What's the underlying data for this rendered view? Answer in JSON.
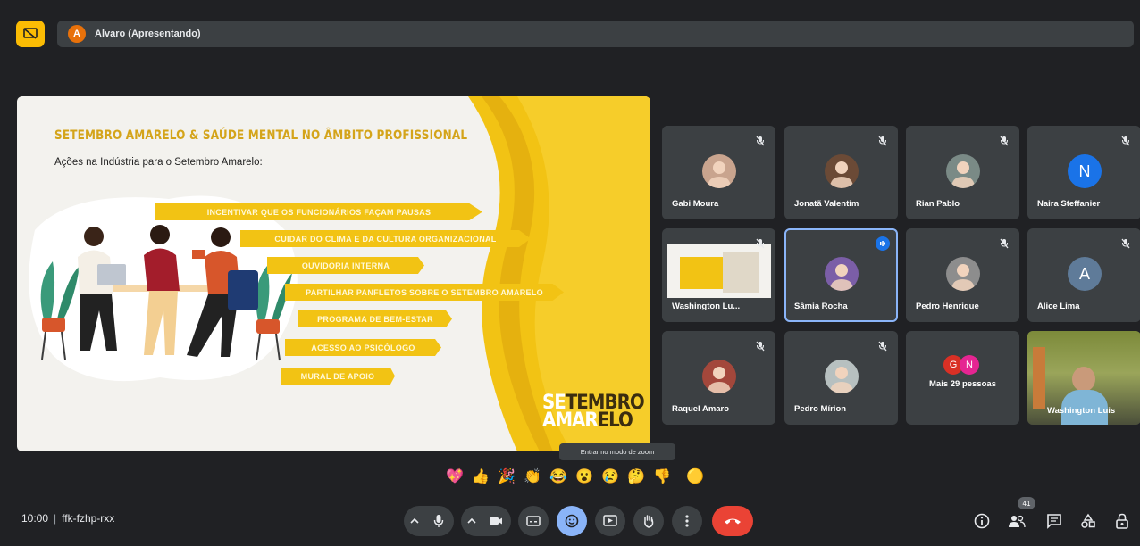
{
  "presenter": {
    "initial": "A",
    "label": "Alvaro (Apresentando)"
  },
  "slide": {
    "title": "SETEMBRO AMARELO & SAÚDE MENTAL NO ÂMBITO PROFISSIONAL",
    "subtitle": "Ações na Indústria para o Setembro Amarelo:",
    "actions": [
      "INCENTIVAR QUE OS FUNCIONÁRIOS FAÇAM PAUSAS",
      "CUIDAR DO CLIMA E DA CULTURA ORGANIZACIONAL",
      "OUVIDORIA INTERNA",
      "PARTILHAR PANFLETOS SOBRE O SETEMBRO AMARELO",
      "PROGRAMA DE BEM-ESTAR",
      "ACESSO AO PSICÓLOGO",
      "MURAL DE APOIO"
    ],
    "brand_line1_a": "SE",
    "brand_line1_b": "TEMBRO",
    "brand_line2_a": "AMAR",
    "brand_line2_b": "ELO"
  },
  "participants": [
    {
      "name": "Gabi Moura",
      "type": "photo",
      "color": "#c9a48e"
    },
    {
      "name": "Jonatã Valentim",
      "type": "photo",
      "color": "#6b4a36"
    },
    {
      "name": "Rian Pablo",
      "type": "photo",
      "color": "#7a8a86"
    },
    {
      "name": "Naira Steffanier",
      "type": "letter",
      "letter": "N",
      "color": "#1a73e8"
    },
    {
      "name": "Washington Lu...",
      "type": "screen"
    },
    {
      "name": "Sâmia Rocha",
      "type": "photo",
      "color": "#7b5ea7",
      "speaking": true
    },
    {
      "name": "Pedro Henrique",
      "type": "photo",
      "color": "#8d8d8d"
    },
    {
      "name": "Alice Lima",
      "type": "letter",
      "letter": "A",
      "color": "#5f7b99"
    },
    {
      "name": "Raquel Amaro",
      "type": "photo",
      "color": "#a3473b"
    },
    {
      "name": "Pedro Mírion",
      "type": "photo",
      "color": "#b7c0c0"
    },
    {
      "name": "Mais 29 pessoas",
      "type": "more",
      "letters": [
        "G",
        "N"
      ]
    },
    {
      "name": "Washington Luis",
      "type": "video"
    }
  ],
  "tooltip": "Entrar no modo de zoom",
  "reactions": [
    "💖",
    "👍",
    "🎉",
    "👏",
    "😂",
    "😮",
    "😢",
    "🤔",
    "👎",
    "🟡"
  ],
  "meeting": {
    "time": "10:00",
    "separator": "|",
    "code": "ffk-fzhp-rxx"
  },
  "participant_count": "41",
  "colors": {
    "accent": "#fbbc04",
    "end_call": "#ea4335",
    "active_control": "#8ab4f8"
  }
}
